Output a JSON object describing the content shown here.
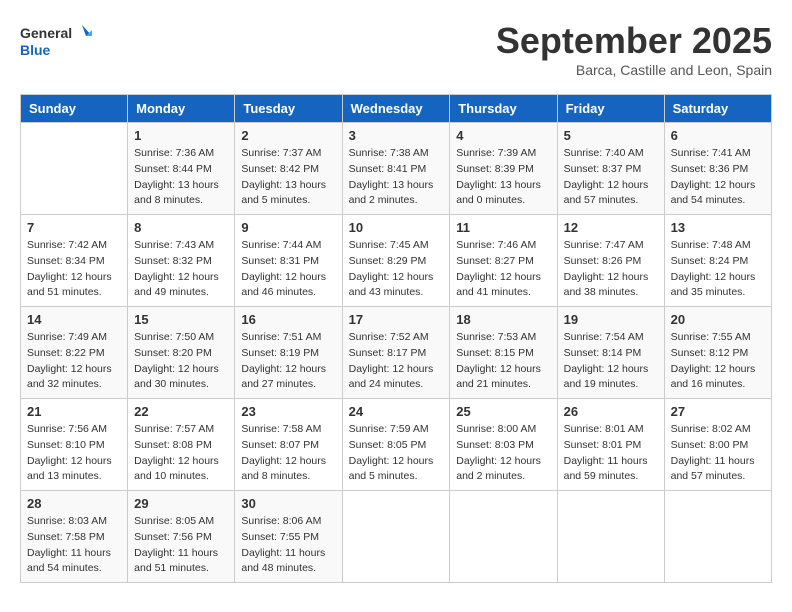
{
  "header": {
    "logo_line1": "General",
    "logo_line2": "Blue",
    "month": "September 2025",
    "location": "Barca, Castille and Leon, Spain"
  },
  "days_of_week": [
    "Sunday",
    "Monday",
    "Tuesday",
    "Wednesday",
    "Thursday",
    "Friday",
    "Saturday"
  ],
  "weeks": [
    [
      {
        "day": "",
        "info": ""
      },
      {
        "day": "1",
        "info": "Sunrise: 7:36 AM\nSunset: 8:44 PM\nDaylight: 13 hours\nand 8 minutes."
      },
      {
        "day": "2",
        "info": "Sunrise: 7:37 AM\nSunset: 8:42 PM\nDaylight: 13 hours\nand 5 minutes."
      },
      {
        "day": "3",
        "info": "Sunrise: 7:38 AM\nSunset: 8:41 PM\nDaylight: 13 hours\nand 2 minutes."
      },
      {
        "day": "4",
        "info": "Sunrise: 7:39 AM\nSunset: 8:39 PM\nDaylight: 13 hours\nand 0 minutes."
      },
      {
        "day": "5",
        "info": "Sunrise: 7:40 AM\nSunset: 8:37 PM\nDaylight: 12 hours\nand 57 minutes."
      },
      {
        "day": "6",
        "info": "Sunrise: 7:41 AM\nSunset: 8:36 PM\nDaylight: 12 hours\nand 54 minutes."
      }
    ],
    [
      {
        "day": "7",
        "info": "Sunrise: 7:42 AM\nSunset: 8:34 PM\nDaylight: 12 hours\nand 51 minutes."
      },
      {
        "day": "8",
        "info": "Sunrise: 7:43 AM\nSunset: 8:32 PM\nDaylight: 12 hours\nand 49 minutes."
      },
      {
        "day": "9",
        "info": "Sunrise: 7:44 AM\nSunset: 8:31 PM\nDaylight: 12 hours\nand 46 minutes."
      },
      {
        "day": "10",
        "info": "Sunrise: 7:45 AM\nSunset: 8:29 PM\nDaylight: 12 hours\nand 43 minutes."
      },
      {
        "day": "11",
        "info": "Sunrise: 7:46 AM\nSunset: 8:27 PM\nDaylight: 12 hours\nand 41 minutes."
      },
      {
        "day": "12",
        "info": "Sunrise: 7:47 AM\nSunset: 8:26 PM\nDaylight: 12 hours\nand 38 minutes."
      },
      {
        "day": "13",
        "info": "Sunrise: 7:48 AM\nSunset: 8:24 PM\nDaylight: 12 hours\nand 35 minutes."
      }
    ],
    [
      {
        "day": "14",
        "info": "Sunrise: 7:49 AM\nSunset: 8:22 PM\nDaylight: 12 hours\nand 32 minutes."
      },
      {
        "day": "15",
        "info": "Sunrise: 7:50 AM\nSunset: 8:20 PM\nDaylight: 12 hours\nand 30 minutes."
      },
      {
        "day": "16",
        "info": "Sunrise: 7:51 AM\nSunset: 8:19 PM\nDaylight: 12 hours\nand 27 minutes."
      },
      {
        "day": "17",
        "info": "Sunrise: 7:52 AM\nSunset: 8:17 PM\nDaylight: 12 hours\nand 24 minutes."
      },
      {
        "day": "18",
        "info": "Sunrise: 7:53 AM\nSunset: 8:15 PM\nDaylight: 12 hours\nand 21 minutes."
      },
      {
        "day": "19",
        "info": "Sunrise: 7:54 AM\nSunset: 8:14 PM\nDaylight: 12 hours\nand 19 minutes."
      },
      {
        "day": "20",
        "info": "Sunrise: 7:55 AM\nSunset: 8:12 PM\nDaylight: 12 hours\nand 16 minutes."
      }
    ],
    [
      {
        "day": "21",
        "info": "Sunrise: 7:56 AM\nSunset: 8:10 PM\nDaylight: 12 hours\nand 13 minutes."
      },
      {
        "day": "22",
        "info": "Sunrise: 7:57 AM\nSunset: 8:08 PM\nDaylight: 12 hours\nand 10 minutes."
      },
      {
        "day": "23",
        "info": "Sunrise: 7:58 AM\nSunset: 8:07 PM\nDaylight: 12 hours\nand 8 minutes."
      },
      {
        "day": "24",
        "info": "Sunrise: 7:59 AM\nSunset: 8:05 PM\nDaylight: 12 hours\nand 5 minutes."
      },
      {
        "day": "25",
        "info": "Sunrise: 8:00 AM\nSunset: 8:03 PM\nDaylight: 12 hours\nand 2 minutes."
      },
      {
        "day": "26",
        "info": "Sunrise: 8:01 AM\nSunset: 8:01 PM\nDaylight: 11 hours\nand 59 minutes."
      },
      {
        "day": "27",
        "info": "Sunrise: 8:02 AM\nSunset: 8:00 PM\nDaylight: 11 hours\nand 57 minutes."
      }
    ],
    [
      {
        "day": "28",
        "info": "Sunrise: 8:03 AM\nSunset: 7:58 PM\nDaylight: 11 hours\nand 54 minutes."
      },
      {
        "day": "29",
        "info": "Sunrise: 8:05 AM\nSunset: 7:56 PM\nDaylight: 11 hours\nand 51 minutes."
      },
      {
        "day": "30",
        "info": "Sunrise: 8:06 AM\nSunset: 7:55 PM\nDaylight: 11 hours\nand 48 minutes."
      },
      {
        "day": "",
        "info": ""
      },
      {
        "day": "",
        "info": ""
      },
      {
        "day": "",
        "info": ""
      },
      {
        "day": "",
        "info": ""
      }
    ]
  ]
}
